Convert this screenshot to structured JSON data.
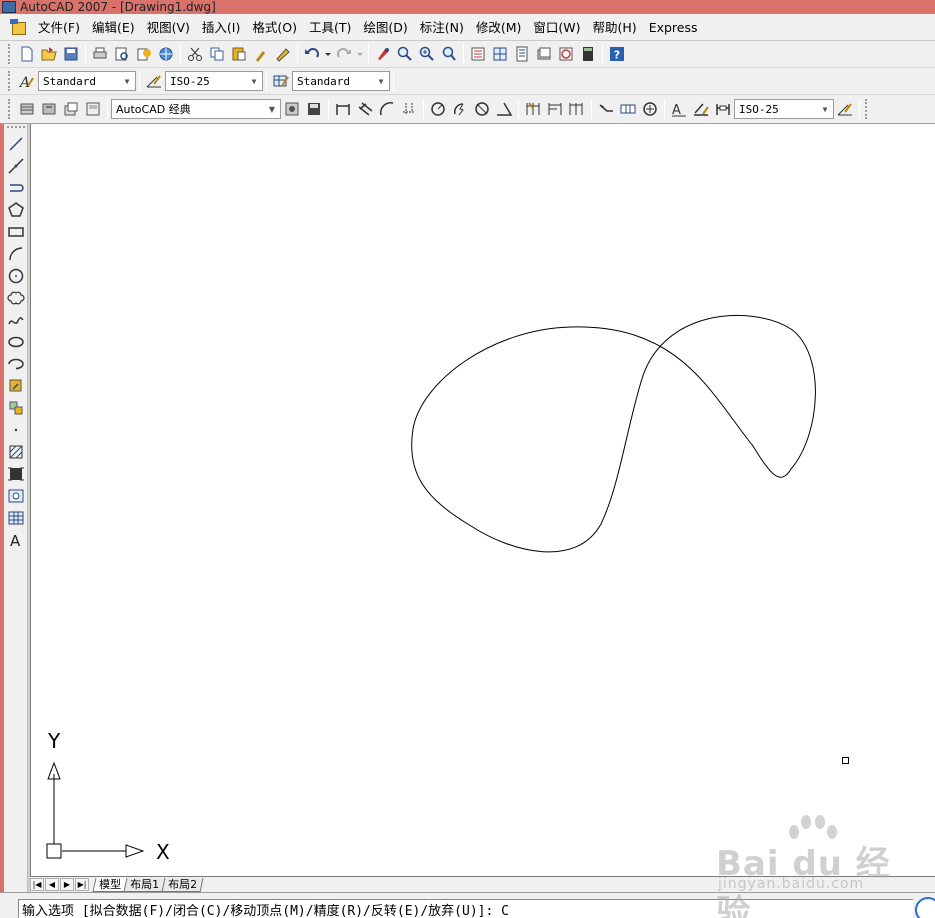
{
  "window": {
    "title": "AutoCAD 2007 - [Drawing1.dwg]"
  },
  "menu": {
    "items": [
      "文件(F)",
      "编辑(E)",
      "视图(V)",
      "插入(I)",
      "格式(O)",
      "工具(T)",
      "绘图(D)",
      "标注(N)",
      "修改(M)",
      "窗口(W)",
      "帮助(H)",
      "Express"
    ]
  },
  "styles_toolbar": {
    "text_style": "Standard",
    "dim_style": "ISO-25",
    "table_style": "Standard"
  },
  "workspace_toolbar": {
    "workspace": "AutoCAD 经典",
    "dim_style": "ISO-25"
  },
  "ucs": {
    "x_label": "X",
    "y_label": "Y"
  },
  "layout_tabs": {
    "items": [
      "模型",
      "布局1",
      "布局2"
    ],
    "active": 0
  },
  "command_line": {
    "text": "输入选项 [拟合数据(F)/闭合(C)/移动顶点(M)/精度(R)/反转(E)/放弃(U)]: C"
  },
  "watermark": {
    "main": "Bai du 经验",
    "sub": "jingyan.baidu.com"
  },
  "colors": {
    "title_bar": "#d8726b",
    "toolbar_bg": "#f0f0f0",
    "canvas_bg": "#ffffff"
  }
}
